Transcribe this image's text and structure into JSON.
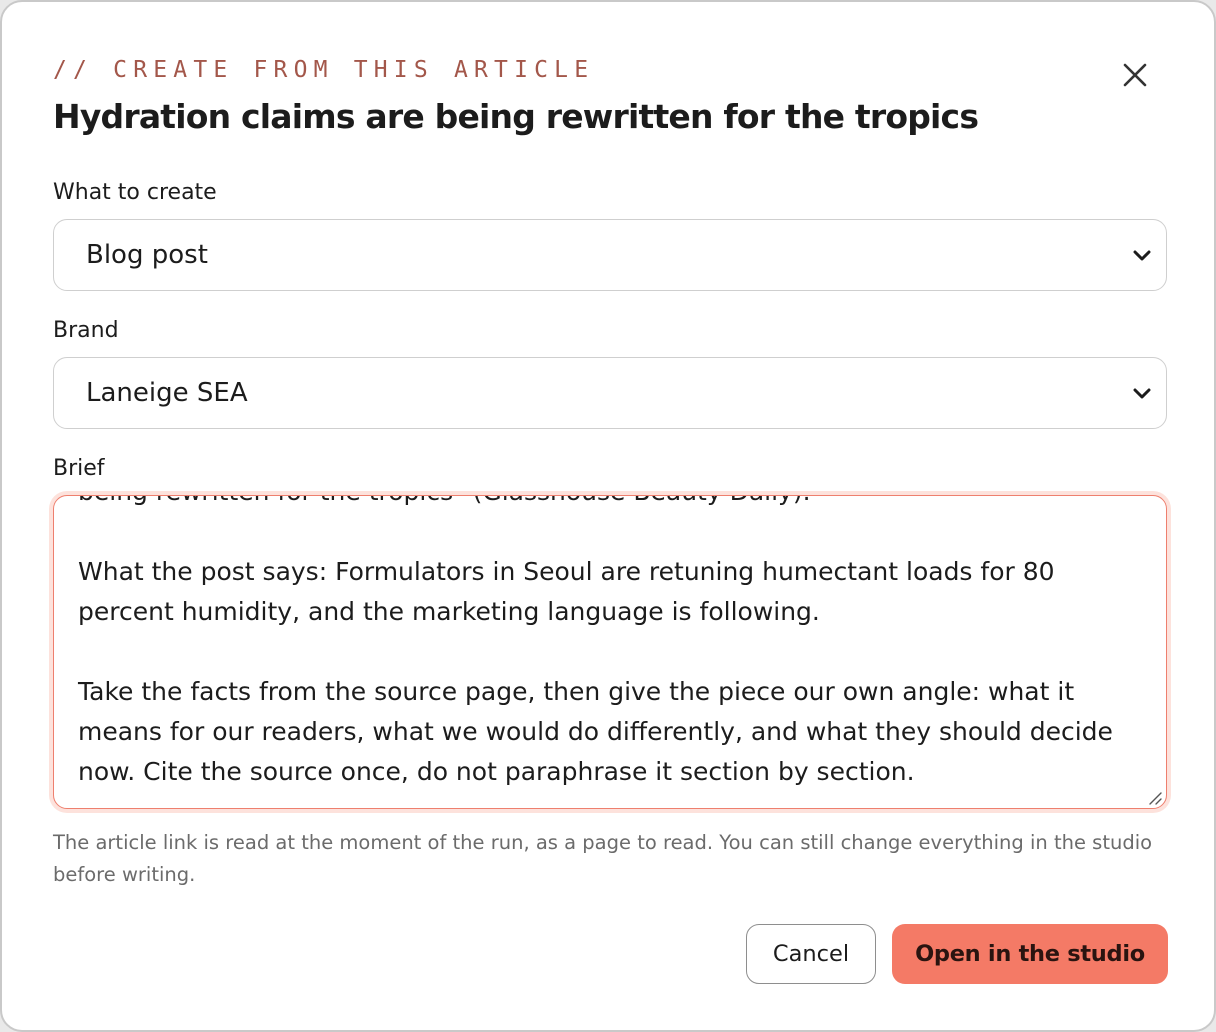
{
  "dialog": {
    "eyebrow": "// CREATE FROM THIS ARTICLE",
    "title": "Hydration claims are being rewritten for the tropics",
    "close_icon": "close-icon"
  },
  "form": {
    "type_field": {
      "label": "What to create",
      "value": "Blog post",
      "icon": "chevron-down-icon"
    },
    "brand_field": {
      "label": "Brand",
      "value": "Laneige SEA",
      "icon": "chevron-down-icon"
    },
    "brief_field": {
      "label": "Brief",
      "paragraphs": [
        "being rewritten for the tropics\" (Glasshouse Beauty Daily).",
        "What the post says: Formulators in Seoul are retuning humectant loads for 80 percent humidity, and the marketing language is following.",
        "Take the facts from the source page, then give the piece our own angle: what it means for our readers, what we would do differently, and what they should decide now. Cite the source once, do not paraphrase it section by section."
      ],
      "icon": "resize-handle-icon"
    },
    "hint": "The article link is read at the moment of the run, as a page to read. You can still change everything in the studio before writing."
  },
  "actions": {
    "cancel_label": "Cancel",
    "submit_label": "Open in the studio"
  },
  "colors": {
    "accent": "#f47a66",
    "eyebrow": "#a3574a",
    "focus_border": "#ee7f6e"
  }
}
